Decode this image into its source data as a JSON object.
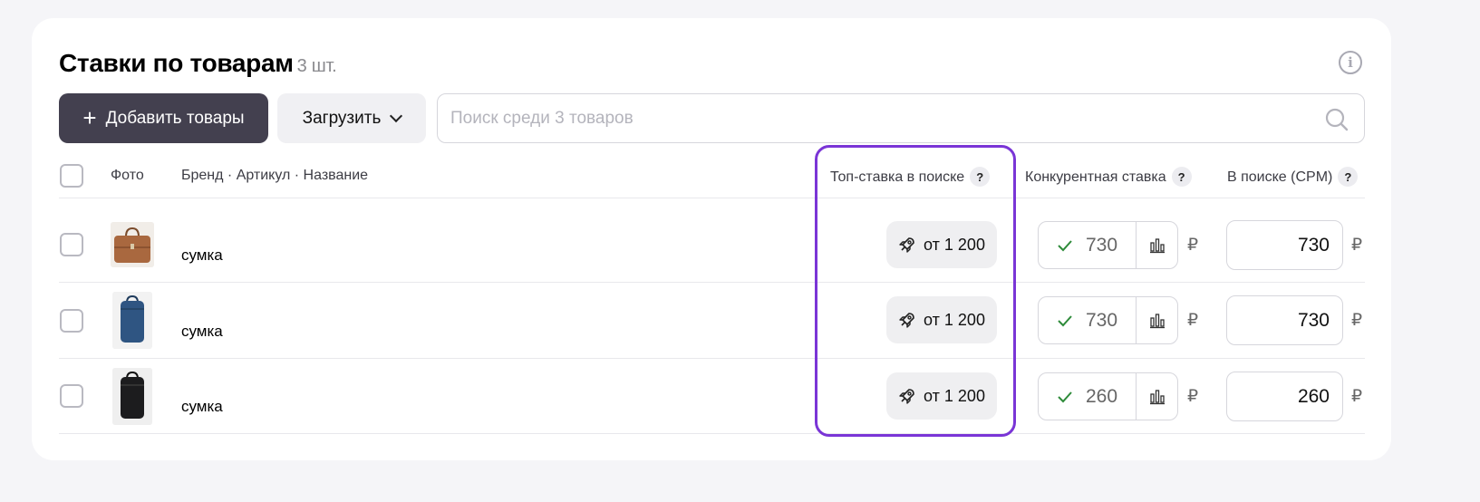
{
  "header": {
    "title": "Ставки по товарам",
    "count": "3 шт."
  },
  "toolbar": {
    "add_label": "Добавить товары",
    "upload_label": "Загрузить",
    "search_placeholder": "Поиск среди 3 товаров"
  },
  "columns": {
    "photo": "Фото",
    "name": "Бренд · Артикул · Название",
    "top_bid": "Топ-ставка в поиске",
    "competitive": "Конкурентная ставка",
    "cpm": "В поиске (CPM)",
    "help": "?"
  },
  "currency": "₽",
  "rows": [
    {
      "name": "сумка",
      "top_bid": "от 1 200",
      "competitive": "730",
      "cpm": "730",
      "photo": "brown-bag"
    },
    {
      "name": "сумка",
      "top_bid": "от 1 200",
      "competitive": "730",
      "cpm": "730",
      "photo": "blue-backpack"
    },
    {
      "name": "сумка",
      "top_bid": "от 1 200",
      "competitive": "260",
      "cpm": "260",
      "photo": "black-backpack"
    }
  ],
  "colors": {
    "highlight": "#7a35d6",
    "primary_button": "#43404f",
    "check": "#2e8b3a"
  }
}
